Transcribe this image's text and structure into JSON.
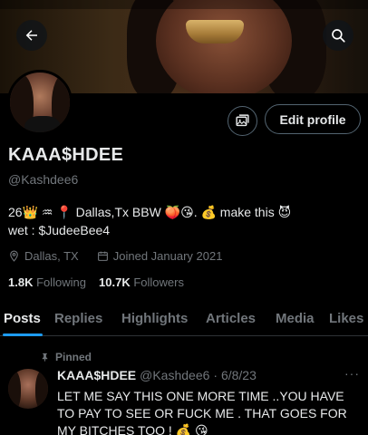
{
  "profile": {
    "display_name": "KAAA$HDEE",
    "handle": "@Kashdee6",
    "bio_line1": "26👑 ♒ 📍 Dallas,Tx BBW 🍑😘. 💰 make this 😈",
    "bio_line2": "wet : $JudeeBee4",
    "location": "Dallas, TX",
    "joined": "Joined January 2021",
    "following_count": "1.8K",
    "following_label": "Following",
    "followers_count": "10.7K",
    "followers_label": "Followers"
  },
  "actions": {
    "edit_profile_label": "Edit profile",
    "back_icon": "arrow-left-icon",
    "search_icon": "search-icon",
    "media_icon": "image-gallery-icon"
  },
  "tabs": [
    "Posts",
    "Replies",
    "Highlights",
    "Articles",
    "Media",
    "Likes"
  ],
  "pinned_tweet": {
    "pinned_label": "Pinned",
    "author_name": "KAAA$HDEE",
    "author_handle": "@Kashdee6",
    "date": "· 6/8/23",
    "text": "LET ME SAY THIS ONE MORE TIME ..YOU HAVE TO PAY TO SEE OR FUCK ME . THAT GOES FOR MY BITCHES TOO ! 💰 😘"
  },
  "colors": {
    "accent": "#1d9bf0",
    "text_primary": "#e7e9ea",
    "text_secondary": "#71767b",
    "border": "#2f3336",
    "background": "#000000"
  }
}
